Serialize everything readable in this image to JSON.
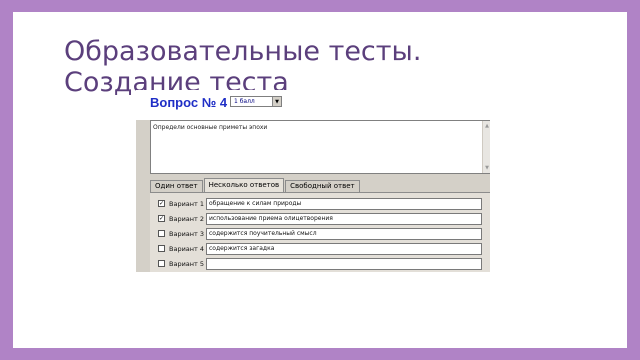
{
  "slide": {
    "title_line1": "Образовательные тесты.",
    "title_line2": "Создание теста"
  },
  "editor": {
    "question_title": "Вопрос № 4",
    "points_value": "1 балл",
    "question_text": "Определи основные приметы эпохи",
    "tabs": [
      {
        "label": "Один ответ",
        "active": false
      },
      {
        "label": "Несколько ответов",
        "active": true
      },
      {
        "label": "Свободный ответ",
        "active": false
      }
    ],
    "options": [
      {
        "label": "Вариант 1",
        "checked": true,
        "value": "обращение к силам природы"
      },
      {
        "label": "Вариант 2",
        "checked": true,
        "value": "использование приема олицетворения"
      },
      {
        "label": "Вариант 3",
        "checked": false,
        "value": "содержится поучительный смысл"
      },
      {
        "label": "Вариант 4",
        "checked": false,
        "value": "содержится загадка"
      },
      {
        "label": "Вариант 5",
        "checked": false,
        "value": ""
      }
    ]
  }
}
